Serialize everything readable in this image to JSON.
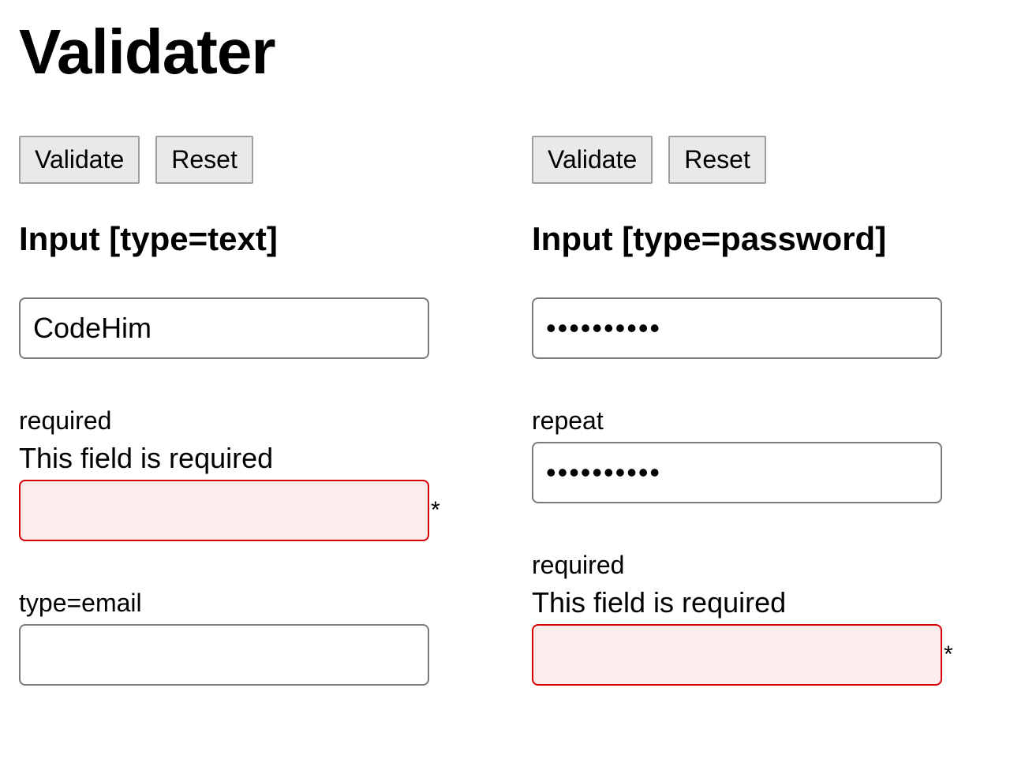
{
  "title": "Validater",
  "left": {
    "buttons": {
      "validate": "Validate",
      "reset": "Reset"
    },
    "heading": "Input [type=text]",
    "field1": {
      "value": "CodeHim"
    },
    "field2": {
      "label": "required",
      "error": "This field is required",
      "value": "",
      "asterisk": "*"
    },
    "field3": {
      "label": "type=email",
      "value": ""
    }
  },
  "right": {
    "buttons": {
      "validate": "Validate",
      "reset": "Reset"
    },
    "heading": "Input [type=password]",
    "field1": {
      "value": "••••••••••"
    },
    "field2": {
      "label": "repeat",
      "value": "••••••••••"
    },
    "field3": {
      "label": "required",
      "error": "This field is required",
      "value": "",
      "asterisk": "*"
    }
  }
}
